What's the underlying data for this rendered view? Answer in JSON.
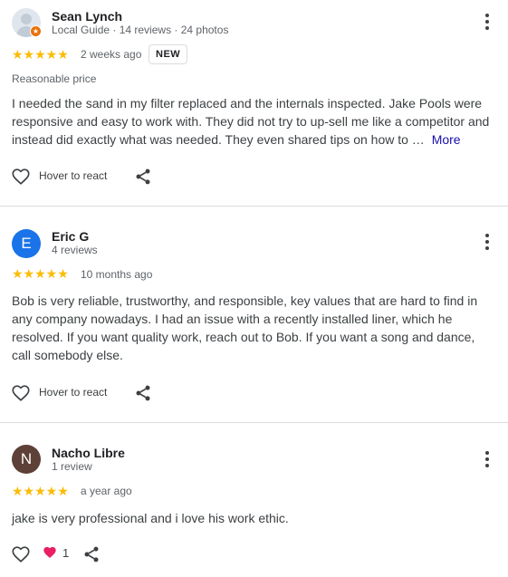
{
  "reviews": [
    {
      "author": "Sean Lynch",
      "meta": "Local Guide · 14 reviews · 24 photos",
      "rating": 5,
      "stars": "★★★★★",
      "time": "2 weeks ago",
      "badge": "NEW",
      "attribute": "Reasonable price",
      "text": "I needed the sand in my filter replaced and the internals inspected. Jake Pools were responsive and easy to work with. They did not try to up-sell me like a competitor and instead did exactly what was needed. They even shared tips on how to …",
      "more_label": "More",
      "react_label": "Hover to react"
    },
    {
      "author": "Eric G",
      "avatar_letter": "E",
      "avatar_color": "#1a73e8",
      "meta": "4 reviews",
      "rating": 5,
      "stars": "★★★★★",
      "time": "10 months ago",
      "text": "Bob is very reliable, trustworthy, and responsible, key values that are hard to find in any company nowadays. I had an issue with a recently installed liner, which he resolved. If you want quality work, reach out to Bob. If you want a song and dance, call somebody else.",
      "react_label": "Hover to react"
    },
    {
      "author": "Nacho Libre",
      "avatar_letter": "N",
      "avatar_color": "#5d4037",
      "meta": "1 review",
      "rating": 5,
      "stars": "★★★★★",
      "time": "a year ago",
      "text": "jake is very professional and i love his work ethic.",
      "reaction_count": "1"
    }
  ],
  "colors": {
    "star": "#fbbc04",
    "link": "#1a0dab",
    "reaction_heart": "#e91e63"
  },
  "icons": [
    "heart-outline-icon",
    "share-icon",
    "more-vert-icon",
    "local-guide-badge-icon",
    "heart-filled-icon"
  ]
}
